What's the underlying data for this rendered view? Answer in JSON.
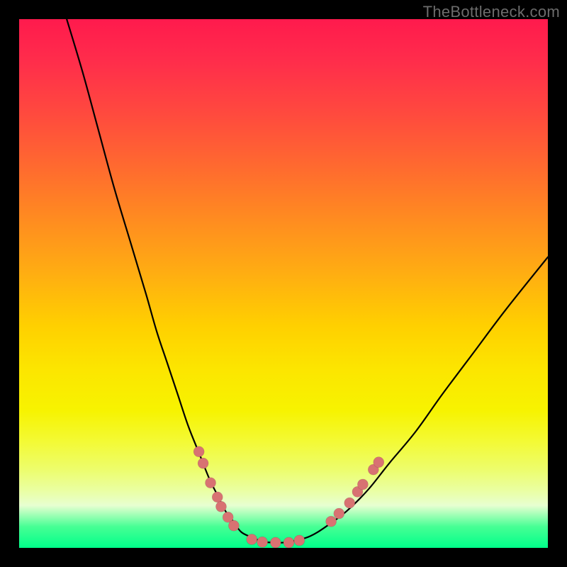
{
  "attribution": "TheBottleneck.com",
  "colors": {
    "page_bg": "#000000",
    "curve_stroke": "#000000",
    "dot_fill": "#d87272",
    "gradient_top": "#ff1a4d",
    "gradient_bottom": "#00ff8a"
  },
  "chart_data": {
    "type": "line",
    "title": "",
    "xlabel": "",
    "ylabel": "",
    "xlim": [
      0,
      100
    ],
    "ylim": [
      0,
      100
    ],
    "axes_visible": false,
    "note": "Visual only; no numeric axes or tick labels are shown. x/y are normalized 0–100 within the plot area, y=0 at bottom.",
    "series": [
      {
        "name": "bottleneck-curve",
        "x": [
          9,
          12,
          15,
          18,
          21,
          24,
          26,
          28,
          30,
          32,
          34,
          36,
          37.5,
          39,
          40.5,
          42,
          44,
          46,
          48,
          50,
          52,
          55,
          58,
          62,
          66,
          70,
          75,
          80,
          86,
          92,
          100
        ],
        "y": [
          100,
          90,
          79,
          68,
          58,
          48,
          41,
          35,
          29,
          23,
          18,
          13,
          10,
          7,
          5,
          3,
          2,
          1.2,
          1,
          1,
          1.3,
          2.2,
          4,
          7,
          11,
          16,
          22,
          29,
          37,
          45,
          55
        ]
      }
    ],
    "markers": [
      {
        "name": "left-cluster-1",
        "x": 34.0,
        "y": 18.2
      },
      {
        "name": "left-cluster-2",
        "x": 34.8,
        "y": 16.0
      },
      {
        "name": "left-cluster-3",
        "x": 36.2,
        "y": 12.3
      },
      {
        "name": "left-cluster-4",
        "x": 37.5,
        "y": 9.6
      },
      {
        "name": "left-cluster-5",
        "x": 38.2,
        "y": 7.8
      },
      {
        "name": "left-cluster-6",
        "x": 39.5,
        "y": 5.8
      },
      {
        "name": "left-cluster-7",
        "x": 40.6,
        "y": 4.2
      },
      {
        "name": "bottom-1",
        "x": 44.0,
        "y": 1.6
      },
      {
        "name": "bottom-2",
        "x": 46.0,
        "y": 1.1
      },
      {
        "name": "bottom-3",
        "x": 48.5,
        "y": 1.0
      },
      {
        "name": "bottom-4",
        "x": 51.0,
        "y": 1.0
      },
      {
        "name": "bottom-5",
        "x": 53.0,
        "y": 1.4
      },
      {
        "name": "right-cluster-1",
        "x": 59.0,
        "y": 5.0
      },
      {
        "name": "right-cluster-2",
        "x": 60.5,
        "y": 6.5
      },
      {
        "name": "right-cluster-3",
        "x": 62.5,
        "y": 8.5
      },
      {
        "name": "right-cluster-4",
        "x": 64.0,
        "y": 10.6
      },
      {
        "name": "right-cluster-5",
        "x": 65.0,
        "y": 12.0
      },
      {
        "name": "right-cluster-6",
        "x": 67.0,
        "y": 14.8
      },
      {
        "name": "right-cluster-7",
        "x": 68.0,
        "y": 16.2
      }
    ]
  }
}
